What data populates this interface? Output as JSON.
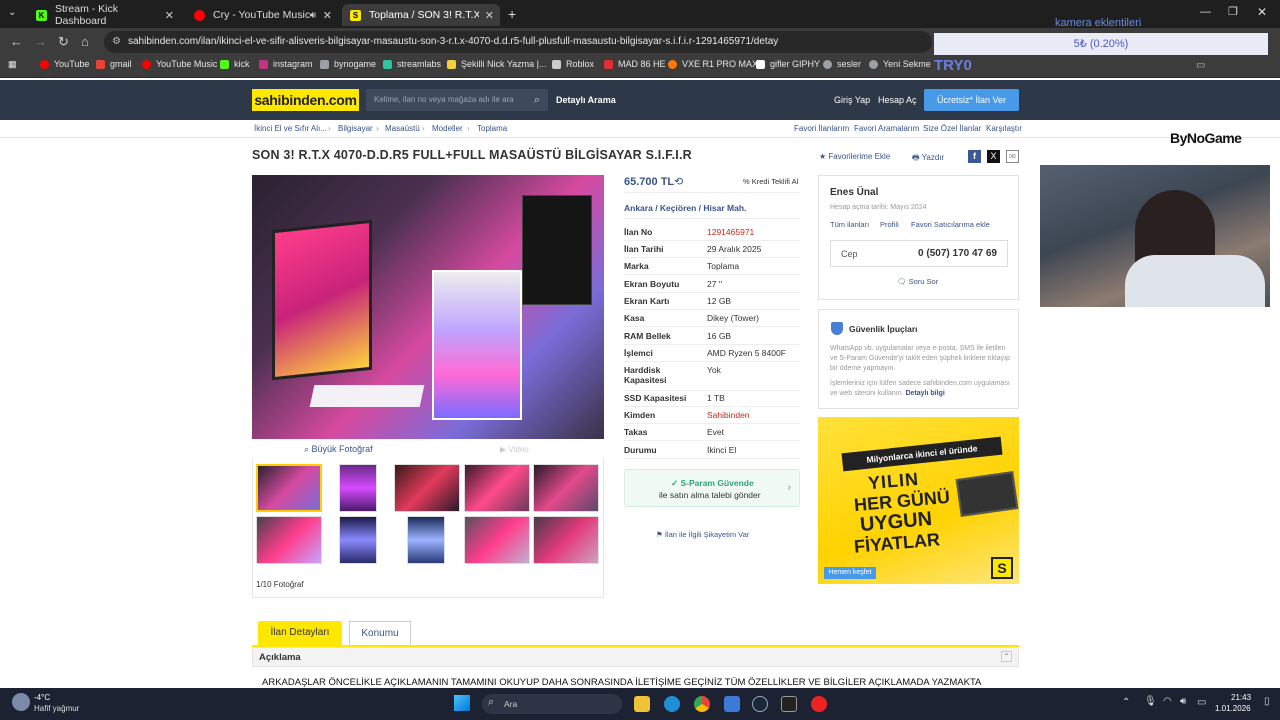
{
  "browser": {
    "tabs": [
      {
        "label": "Stream - Kick Dashboard",
        "color": "#53fc18"
      },
      {
        "label": "Cry - YouTube Music",
        "color": "#ff0000"
      },
      {
        "label": "Toplama / SON 3! R.T.X 4070-D.D",
        "color": "#ffe800"
      }
    ],
    "url": "sahibinden.com/ilan/ikinci-el-ve-sifir-alisveris-bilgisayar-masaustu-son-3-r.t.x-4070-d.d.r5-full-plusfull-masaustu-bilgisayar-s.i.f.i.r-1291465971/detay",
    "bookmarks": [
      {
        "label": "YouTube",
        "color": "#ff0000"
      },
      {
        "label": "gmail",
        "color": "#ea4335"
      },
      {
        "label": "YouTube Music",
        "color": "#ff0000"
      },
      {
        "label": "kick",
        "color": "#53fc18"
      },
      {
        "label": "instagram",
        "color": "#c13584"
      },
      {
        "label": "bynogame",
        "color": "#9aa0a6"
      },
      {
        "label": "streamlabs",
        "color": "#31c3a2"
      },
      {
        "label": "Şekilli Nick Yazma |...",
        "color": "#f4d03f"
      },
      {
        "label": "Roblox",
        "color": "#cccccc"
      },
      {
        "label": "MAD 86 HE",
        "color": "#e23030"
      },
      {
        "label": "VXE R1 PRO MAX",
        "color": "#ff7a00"
      },
      {
        "label": "gifler GIPHY",
        "color": "#ffffff"
      },
      {
        "label": "sesler",
        "color": "#9aa0a6"
      },
      {
        "label": "Yeni Sekme",
        "color": "#9aa0a6"
      }
    ]
  },
  "overlay": {
    "camera_label": "kamera eklentileri",
    "goal": "5₺ (0.20%)",
    "try_label": "TRY0",
    "brand": "ByNoGame"
  },
  "site": {
    "logo": "sahibinden.com",
    "search_placeholder": "Kelime, ilan no veya mağaza adı ile ara",
    "detailed_search": "Detaylı Arama",
    "login": "Giriş Yap",
    "register": "Hesap Aç",
    "cta": "Ücretsiz* İlan Ver"
  },
  "breadcrumb": [
    "İkinci El ve Sıfır Alı...",
    "Bilgisayar",
    "Masaüstü",
    "Modeller",
    "Toplama"
  ],
  "right_links": [
    "Favori İlanlarım",
    "Favori Aramalarım",
    "Size Özel İlanlar",
    "Karşılaştır"
  ],
  "listing": {
    "title": "SON 3! R.T.X 4070-D.D.R5 FULL+FULL MASAÜSTÜ BİLGİSAYAR S.I.F.I.R",
    "add_fav": "Favorilerime Ekle",
    "print": "Yazdır",
    "price": "65.700 TL",
    "credit": "Kredi Teklifi Al",
    "location": [
      "Ankara",
      "Keçiören",
      "Hisar Mah."
    ],
    "big_photo": "Büyük Fotoğraf",
    "video": "Video",
    "photo_count": "1/10 Fotoğraf",
    "details": [
      {
        "label": "İlan No",
        "value": "1291465971"
      },
      {
        "label": "İlan Tarihi",
        "value": "29 Aralık 2025"
      },
      {
        "label": "Marka",
        "value": "Toplama"
      },
      {
        "label": "Ekran Boyutu",
        "value": "27 ''"
      },
      {
        "label": "Ekran Kartı",
        "value": "12 GB"
      },
      {
        "label": "Kasa",
        "value": "Dikey (Tower)"
      },
      {
        "label": "RAM Bellek",
        "value": "16 GB"
      },
      {
        "label": "İşlemci",
        "value": "AMD Ryzen 5 8400F"
      },
      {
        "label": "Harddisk Kapasitesi",
        "value": "Yok"
      },
      {
        "label": "SSD Kapasitesi",
        "value": "1 TB"
      },
      {
        "label": "Kimden",
        "value": "Sahibinden"
      },
      {
        "label": "Takas",
        "value": "Evet"
      },
      {
        "label": "Durumu",
        "value": "İkinci El"
      }
    ],
    "sparam_title": "S-Param Güvende",
    "sparam_sub": "ile satın alma talebi gönder",
    "complaint": "İlan ile İlgili Şikayetim Var"
  },
  "seller": {
    "name": "Enes Ünal",
    "since": "Hesap açma tarihi: Mayıs 2024",
    "links": [
      "Tüm ilanları",
      "Profili",
      "Favori Satıcılarıma ekle"
    ],
    "phone_label": "Cep",
    "phone": "0 (507) 170 47 69",
    "ask": "Soru Sor"
  },
  "safety": {
    "title": "Güvenlik İpuçları",
    "text1": "WhatsApp vb. uygulamalar veya e-posta, SMS ile iletilen ve S-Param Güvende'yi taklit eden şüpheli linklere tıklayıp bir ödeme yapmayın.",
    "text2": "İşlemleriniz için lütfen sadece sahibinden.com uygulaması ve web sitesini kullanın.",
    "more": "Detaylı bilgi"
  },
  "ad": {
    "banner": "Milyonlarca ikinci el üründe",
    "line1": "YILIN",
    "line2": "HER GÜNÜ",
    "line3": "UYGUN",
    "line4": "FİYATLAR",
    "button": "Hemen keşfet"
  },
  "tabs_bottom": {
    "active": "İlan Detayları",
    "other": "Konumu"
  },
  "description": {
    "heading": "Açıklama",
    "text": "ARKADAŞLAR ÖNCELİKLE AÇIKLAMANIN TAMAMINI OKUYUP DAHA SONRASINDA İLETİŞİME GEÇİNİZ TÜM ÖZELLİKLER VE BİLGİLER AÇIKLAMADA YAZMAKTA"
  },
  "taskbar": {
    "temp": "-4°C",
    "weather": "Hafif yağmur",
    "search": "Ara",
    "time": "21:43",
    "date": "1.01.2026"
  }
}
